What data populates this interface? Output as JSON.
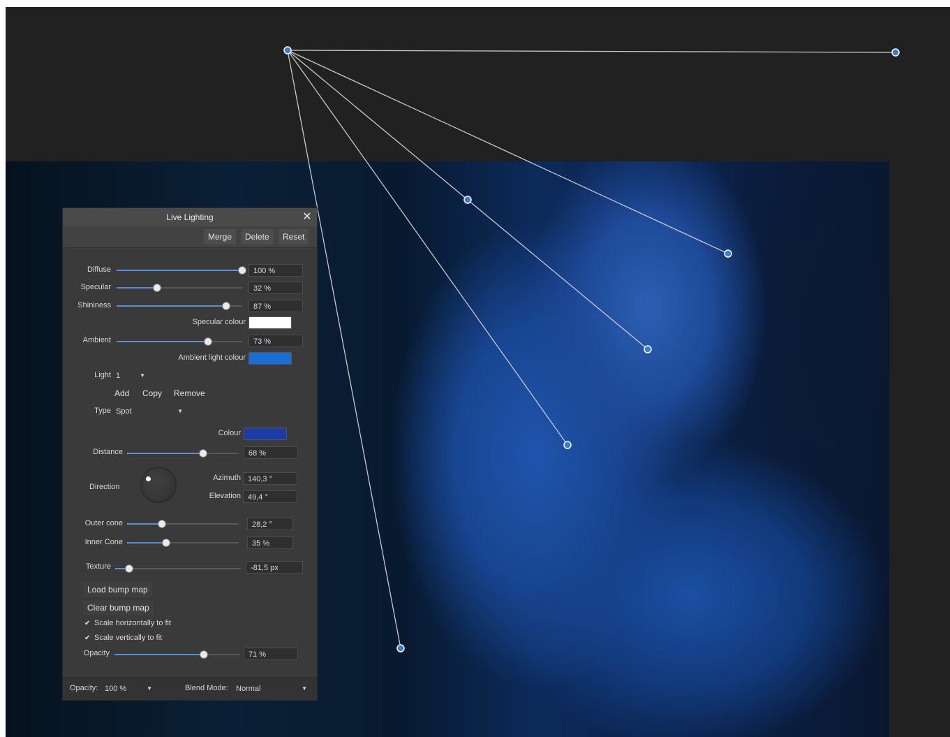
{
  "panel": {
    "title": "Live Lighting",
    "close_label": "✕",
    "toolbar": {
      "merge": "Merge",
      "delete": "Delete",
      "reset": "Reset"
    },
    "diffuse": {
      "label": "Diffuse",
      "value": "100 %",
      "fraction": 1.0
    },
    "specular": {
      "label": "Specular",
      "value": "32 %",
      "fraction": 0.32
    },
    "shininess": {
      "label": "Shininess",
      "value": "87 %",
      "fraction": 0.87
    },
    "specular_colour": {
      "label": "Specular colour",
      "color": "#ffffff"
    },
    "ambient": {
      "label": "Ambient",
      "value": "73 %",
      "fraction": 0.73
    },
    "ambient_light_colour": {
      "label": "Ambient light colour",
      "color": "#1a6fd6"
    },
    "light": {
      "label": "Light",
      "value": "1"
    },
    "light_buttons": {
      "add": "Add",
      "copy": "Copy",
      "remove": "Remove"
    },
    "type": {
      "label": "Type",
      "value": "Spot"
    },
    "colour": {
      "label": "Colour",
      "color": "#1b3ca8"
    },
    "distance": {
      "label": "Distance",
      "value": "68 %",
      "fraction": 0.68
    },
    "direction": {
      "label": "Direction"
    },
    "azimuth": {
      "label": "Azimuth",
      "value": "140,3 °"
    },
    "elevation": {
      "label": "Elevation",
      "value": "49,4 °"
    },
    "outer_cone": {
      "label": "Outer cone",
      "value": "28,2 °",
      "fraction": 0.31
    },
    "inner_cone": {
      "label": "Inner Cone",
      "value": "35 %",
      "fraction": 0.35
    },
    "texture": {
      "label": "Texture",
      "value": "-81,5 px",
      "fraction": 0.11
    },
    "load_bump_map": "Load bump map",
    "clear_bump_map": "Clear bump map",
    "scale_horizontally": {
      "label": "Scale horizontally to fit",
      "checked": true
    },
    "scale_vertically": {
      "label": "Scale vertically to fit",
      "checked": true
    },
    "light_opacity": {
      "label": "Opacity",
      "value": "71 %",
      "fraction": 0.71
    },
    "footer": {
      "opacity_label": "Opacity:",
      "opacity_value": "100 %",
      "blend_mode_label": "Blend Mode:",
      "blend_mode_value": "Normal"
    }
  },
  "colors": {
    "handle": "#3a7bd5",
    "guide_line": "#c8c8c8",
    "canvas_bg": "#212121"
  }
}
